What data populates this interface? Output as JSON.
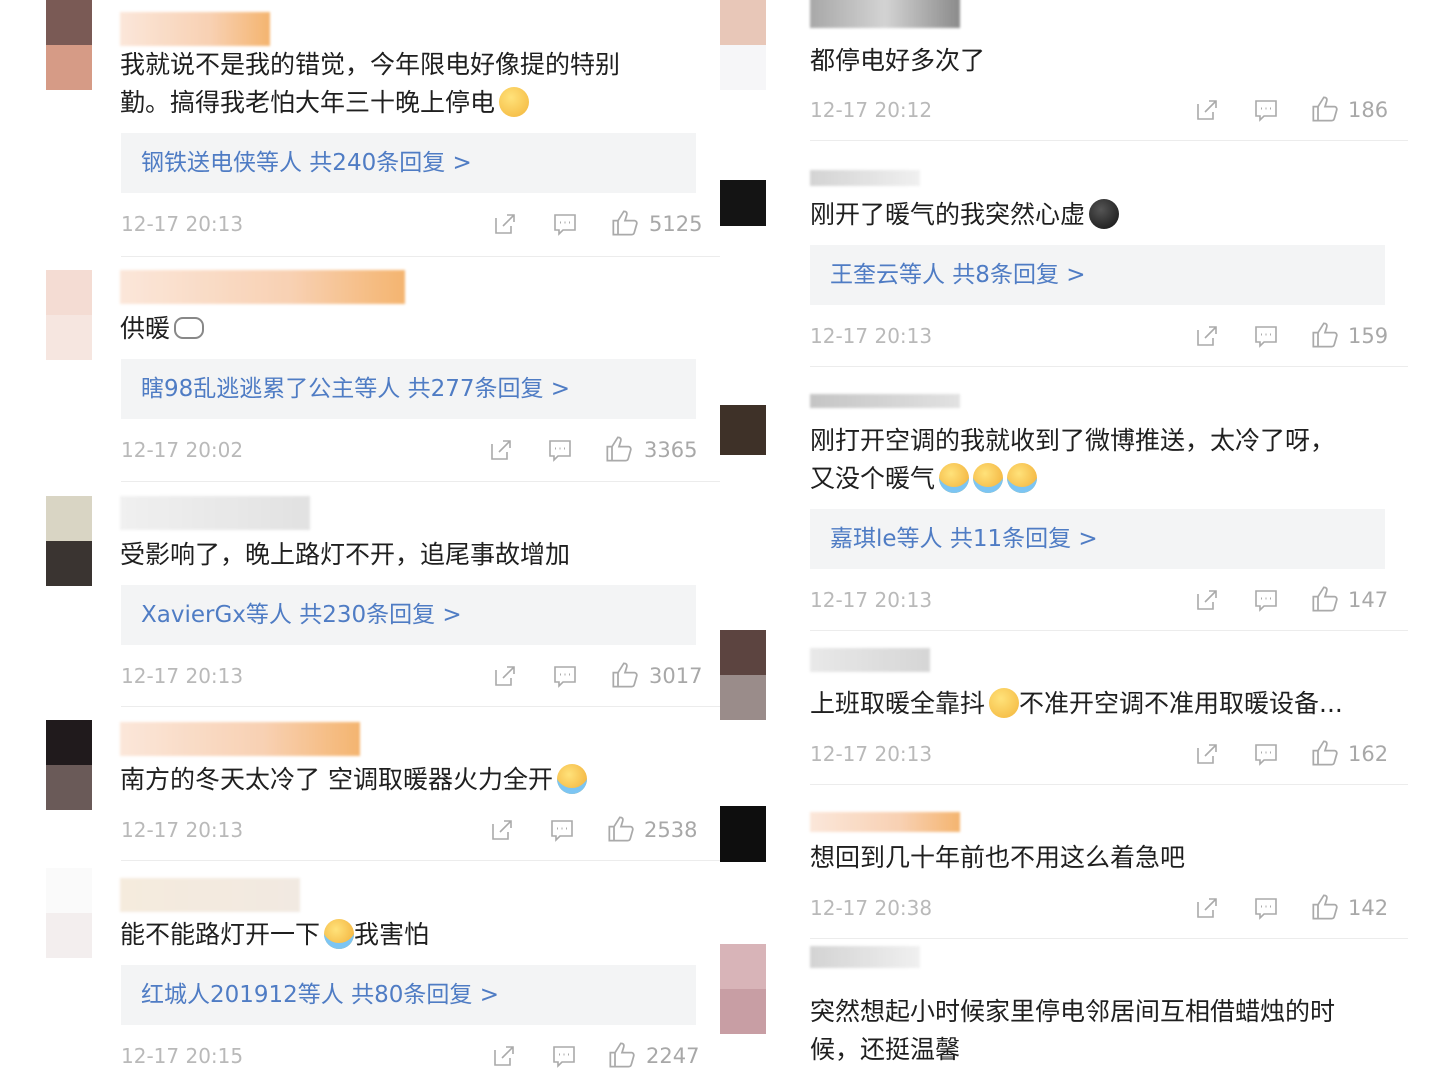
{
  "left": {
    "comments": [
      {
        "name": "",
        "text_line1": "我就说不是我的错觉，今年限电好像提的特别",
        "text_line2": "勤。搞得我老怕大年三十晚上停电",
        "emoji": "thinking-emoji",
        "replies": "钢铁送电侠等人  共240条回复 >",
        "time": "12-17 20:13",
        "likes": "5125"
      },
      {
        "name": "",
        "text_line1": "供暖",
        "emoji": "glasses-emoji",
        "replies": "瞎98乱逃逃累了公主等人  共277条回复 >",
        "time": "12-17 20:02",
        "likes": "3365"
      },
      {
        "name": "",
        "text_line1": "受影响了，晚上路灯不开，追尾事故增加",
        "replies": "XavierGx等人  共230条回复 >",
        "time": "12-17 20:13",
        "likes": "3017"
      },
      {
        "name": "",
        "text_line1": "南方的冬天太冷了 空调取暖器火力全开",
        "emoji": "laughing-crying-emoji",
        "time": "12-17 20:13",
        "likes": "2538"
      },
      {
        "name": "",
        "text_line1": "能不能路灯开一下",
        "text_line1b": "我害怕",
        "emoji": "crying-emoji",
        "replies": "红城人201912等人  共80条回复 >",
        "time": "12-17 20:15",
        "likes": "2247"
      }
    ]
  },
  "right": {
    "comments": [
      {
        "name": "",
        "text_line1": "都停电好多次了",
        "time": "12-17 20:12",
        "likes": "186"
      },
      {
        "name": "",
        "text_line1": "刚开了暖气的我突然心虚",
        "emoji": "nervous-emoji",
        "replies": "王奎云等人  共8条回复 >",
        "time": "12-17 20:13",
        "likes": "159"
      },
      {
        "name": "",
        "text_line1": "刚打开空调的我就收到了微博推送，太冷了呀，",
        "text_line2": "又没个暖气",
        "emoji": "laughing-crying-emoji",
        "replies": "嘉琪le等人  共11条回复 >",
        "time": "12-17 20:13",
        "likes": "147"
      },
      {
        "name": "",
        "text_line1": "上班取暖全靠抖",
        "text_line1b": "不准开空调不准用取暖设备...",
        "emoji": "tongue-emoji",
        "time": "12-17 20:13",
        "likes": "162"
      },
      {
        "name": "",
        "text_line1": "想回到几十年前也不用这么着急吧",
        "time": "12-17 20:38",
        "likes": "142"
      },
      {
        "name": "",
        "text_line1": "突然想起小时候家里停电邻居间互相借蜡烛的时",
        "text_line2": "候，还挺温馨"
      }
    ]
  },
  "icons": {
    "share": "share-icon",
    "comment": "comment-icon",
    "like": "thumbs-up-icon"
  },
  "colors": {
    "reply_link": "#4f7cc4",
    "meta_gray": "#b9b9b9",
    "reply_bg": "#f3f4f5"
  }
}
